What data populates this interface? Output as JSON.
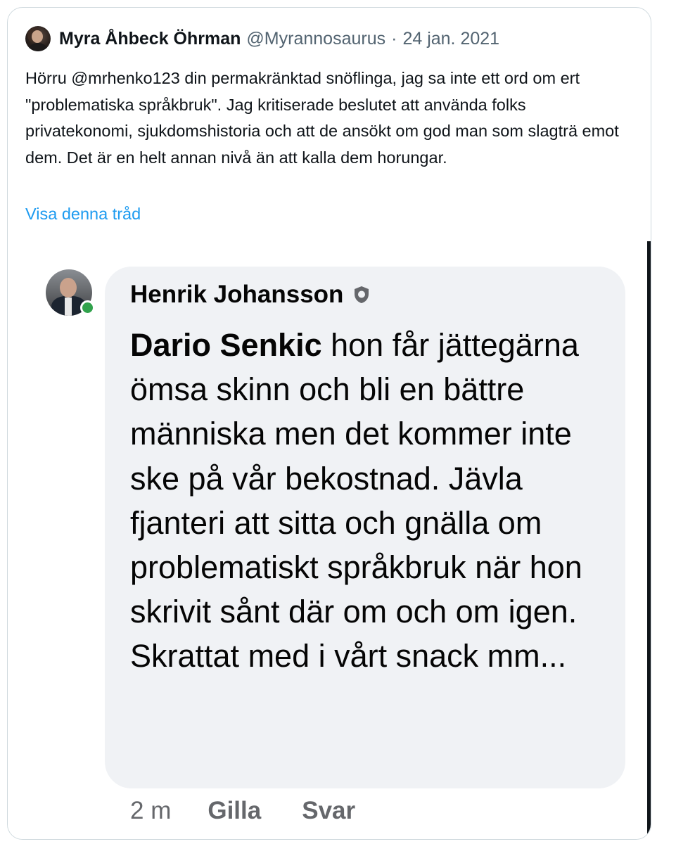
{
  "tweet": {
    "display_name": "Myra Åhbeck Öhrman",
    "handle": "@Myrannosaurus",
    "separator": "·",
    "date": "24 jan. 2021",
    "text": "Hörru @mrhenko123 din permakränktad snöflinga, jag sa inte ett ord om ert \"problematiska språkbruk\". Jag kritiserade beslutet att använda folks privatekonomi, sjukdomshistoria och att de ansökt om god man som slagträ emot dem. Det är en helt annan nivå än att kalla dem horungar.",
    "show_thread": "Visa denna tråd"
  },
  "embedded_comment": {
    "commenter_name": "Henrik Johansson",
    "badge_icon": "shield-badge-icon",
    "mention": "Dario Senkic",
    "text": " hon får jättegärna ömsa skinn och bli en bättre människa men det kommer inte ske på vår bekostnad. Jävla fjanteri att sitta och gnälla om problematiskt språkbruk när hon skrivit sånt där om och om igen. Skrattat med i vårt snack mm...",
    "time": "2 m",
    "like_label": "Gilla",
    "reply_label": "Svar",
    "online_status_color": "#31a24c",
    "bubble_color": "#f0f2f5"
  },
  "colors": {
    "link": "#1d9bf0",
    "secondary_text": "#536471",
    "border": "#cfd9de"
  }
}
